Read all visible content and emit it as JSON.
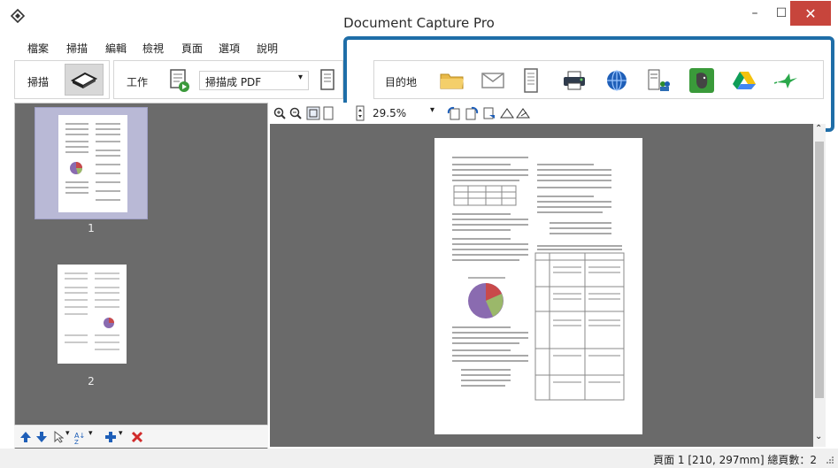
{
  "window": {
    "title": "Document Capture Pro",
    "minimize_glyph": "–",
    "maximize_glyph": "☐",
    "close_glyph": "✕"
  },
  "menubar": {
    "items": [
      "檔案",
      "掃描",
      "編輯",
      "檢視",
      "頁面",
      "選項",
      "說明"
    ]
  },
  "toolbar": {
    "scan_label": "掃描",
    "job_label": "工作",
    "job_value": "掃描成 PDF",
    "destination_label": "目的地"
  },
  "destinations": [
    {
      "icon": "folder-icon"
    },
    {
      "icon": "email-icon"
    },
    {
      "icon": "document-icon"
    },
    {
      "icon": "printer-icon"
    },
    {
      "icon": "web-icon"
    },
    {
      "icon": "sharepoint-icon"
    },
    {
      "icon": "evernote-icon"
    },
    {
      "icon": "google-drive-icon"
    },
    {
      "icon": "hummingbird-icon"
    }
  ],
  "thumbnails": [
    {
      "number": "1",
      "selected": true
    },
    {
      "number": "2",
      "selected": false
    }
  ],
  "viewer": {
    "zoom": "29.5%"
  },
  "status": {
    "text": "頁面 1 [210, 297mm]  總頁數：2"
  },
  "colors": {
    "highlight": "#1f6ea8",
    "close_button": "#c7453c",
    "panel_gray": "#6b6b6b"
  }
}
